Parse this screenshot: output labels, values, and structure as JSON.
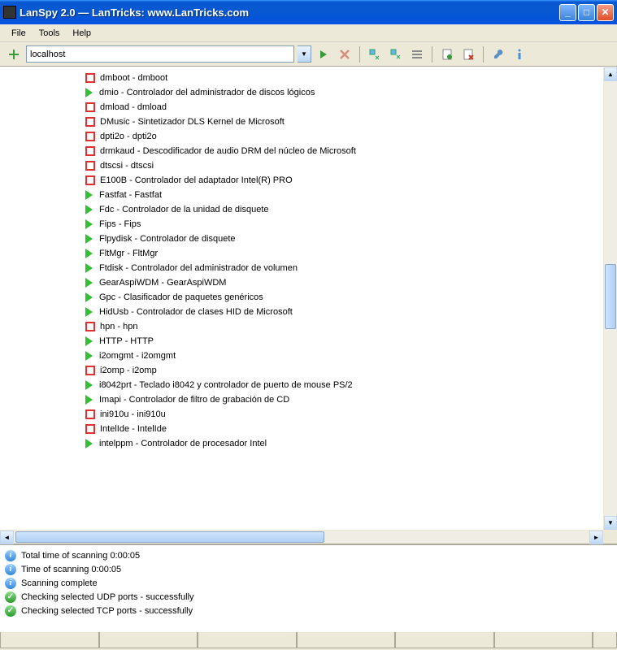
{
  "window": {
    "title": "LanSpy 2.0 — LanTricks: www.LanTricks.com"
  },
  "menu": {
    "file": "File",
    "tools": "Tools",
    "help": "Help"
  },
  "toolbar": {
    "host_value": "localhost"
  },
  "tree": {
    "items": [
      {
        "state": "stop",
        "label": "dmboot - dmboot"
      },
      {
        "state": "run",
        "label": "dmio - Controlador del administrador de discos lógicos"
      },
      {
        "state": "stop",
        "label": "dmload - dmload"
      },
      {
        "state": "stop",
        "label": "DMusic - Sintetizador DLS Kernel de Microsoft"
      },
      {
        "state": "stop",
        "label": "dpti2o - dpti2o"
      },
      {
        "state": "stop",
        "label": "drmkaud - Descodificador de audio DRM del núcleo de Microsoft"
      },
      {
        "state": "stop",
        "label": "dtscsi - dtscsi"
      },
      {
        "state": "stop",
        "label": "E100B - Controlador del adaptador Intel(R) PRO"
      },
      {
        "state": "run",
        "label": "Fastfat - Fastfat"
      },
      {
        "state": "run",
        "label": "Fdc - Controlador de la unidad de disquete"
      },
      {
        "state": "run",
        "label": "Fips - Fips"
      },
      {
        "state": "run",
        "label": "Flpydisk - Controlador de disquete"
      },
      {
        "state": "run",
        "label": "FltMgr - FltMgr"
      },
      {
        "state": "run",
        "label": "Ftdisk - Controlador del administrador de volumen"
      },
      {
        "state": "run",
        "label": "GearAspiWDM - GearAspiWDM"
      },
      {
        "state": "run",
        "label": "Gpc - Clasificador de paquetes genéricos"
      },
      {
        "state": "run",
        "label": "HidUsb - Controlador de clases HID de Microsoft"
      },
      {
        "state": "stop",
        "label": "hpn - hpn"
      },
      {
        "state": "run",
        "label": "HTTP - HTTP"
      },
      {
        "state": "run",
        "label": "i2omgmt - i2omgmt"
      },
      {
        "state": "stop",
        "label": "i2omp - i2omp"
      },
      {
        "state": "run",
        "label": "i8042prt - Teclado i8042 y controlador de puerto de mouse PS/2"
      },
      {
        "state": "run",
        "label": "Imapi - Controlador de filtro de grabación de CD"
      },
      {
        "state": "stop",
        "label": "ini910u - ini910u"
      },
      {
        "state": "stop",
        "label": "IntelIde - IntelIde"
      },
      {
        "state": "run",
        "label": "intelppm - Controlador de procesador Intel"
      }
    ]
  },
  "log": {
    "entries": [
      {
        "type": "info",
        "text": "Total time of scanning 0:00:05"
      },
      {
        "type": "info",
        "text": "Time of scanning 0:00:05"
      },
      {
        "type": "info",
        "text": "Scanning complete"
      },
      {
        "type": "ok",
        "text": "Checking selected UDP ports - successfully"
      },
      {
        "type": "ok",
        "text": "Checking selected TCP ports - successfully"
      }
    ]
  }
}
